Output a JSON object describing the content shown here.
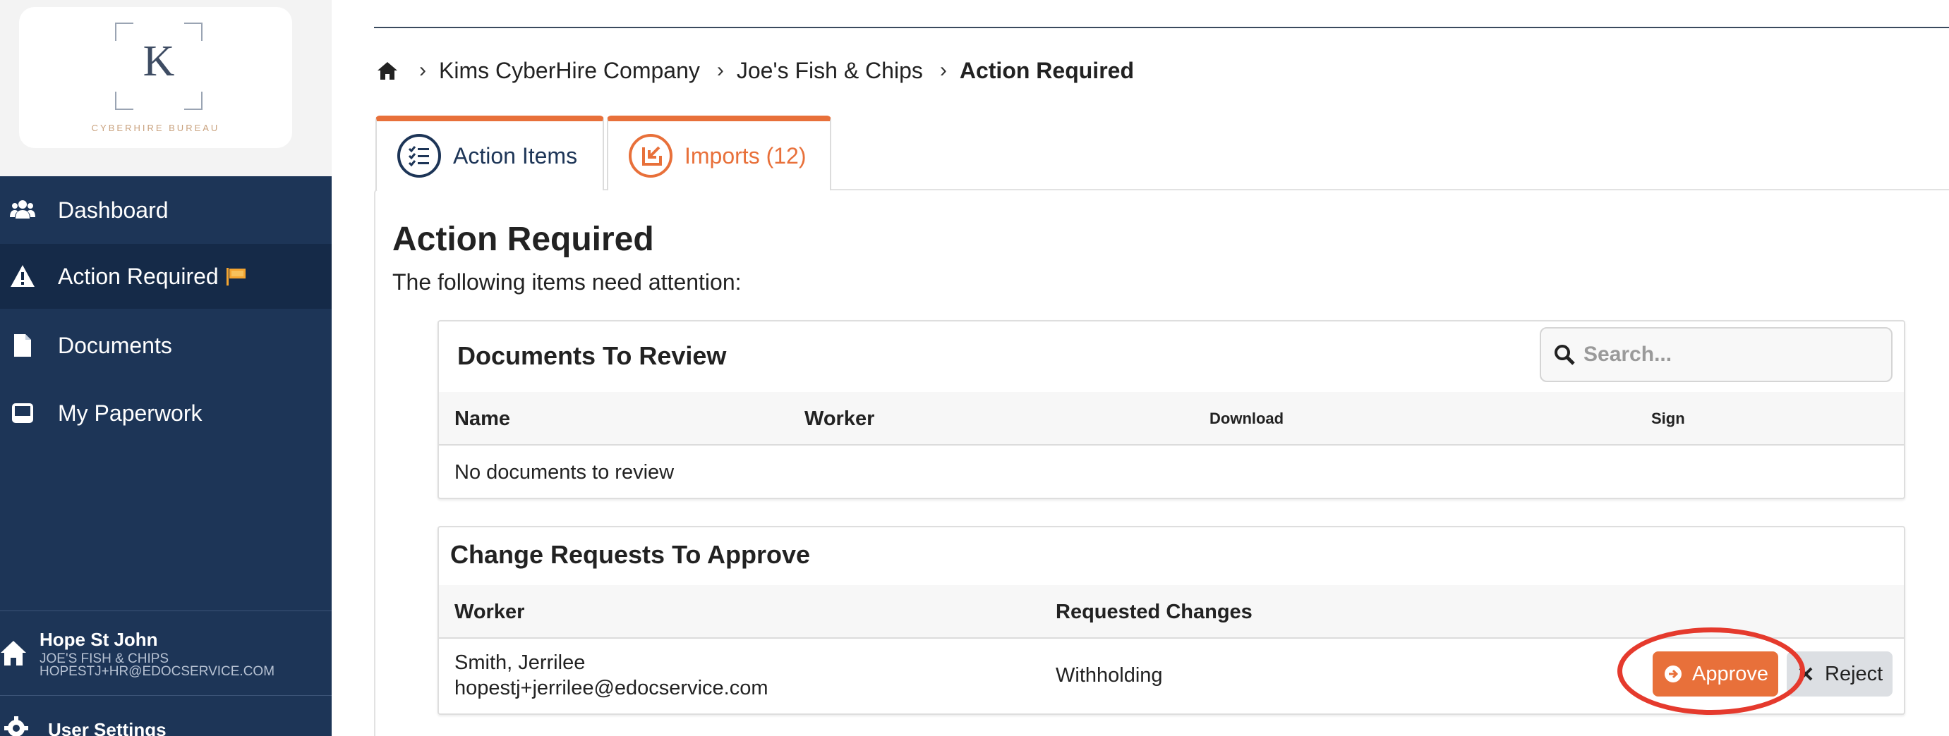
{
  "brand": {
    "logo_letter": "K",
    "logo_text": "CYBERHIRE BUREAU"
  },
  "sidebar": {
    "items": [
      {
        "label": "Dashboard",
        "icon": "users-icon"
      },
      {
        "label": "Action Required",
        "icon": "warning-icon",
        "badge_icon": "flag-icon"
      },
      {
        "label": "Documents",
        "icon": "document-icon"
      },
      {
        "label": "My Paperwork",
        "icon": "inbox-icon"
      }
    ],
    "user": {
      "name": "Hope St John",
      "company": "JOE'S FISH & CHIPS",
      "email": "HOPESTJ+HR@EDOCSERVICE.COM"
    },
    "settings_label": "User Settings"
  },
  "breadcrumb": {
    "items": [
      "Kims CyberHire Company",
      "Joe's Fish & Chips"
    ],
    "current": "Action Required"
  },
  "tabs": [
    {
      "label": "Action Items",
      "active": true
    },
    {
      "label": "Imports (12)",
      "active": false
    }
  ],
  "page": {
    "title": "Action Required",
    "subtitle": "The following items need attention:"
  },
  "documents_card": {
    "title": "Documents To Review",
    "search_placeholder": "Search...",
    "columns": [
      "Name",
      "Worker",
      "Download",
      "Sign"
    ],
    "empty_message": "No documents to review"
  },
  "change_requests_card": {
    "title": "Change Requests To Approve",
    "columns": [
      "Worker",
      "Requested Changes"
    ],
    "rows": [
      {
        "worker_name": "Smith, Jerrilee",
        "worker_email": "hopestj+jerrilee@edocservice.com",
        "requested_changes": "Withholding",
        "approve_label": "Approve",
        "reject_label": "Reject"
      }
    ]
  },
  "colors": {
    "sidebar": "#1d3557",
    "accent": "#e8703a",
    "annotation": "#e53a2d"
  }
}
